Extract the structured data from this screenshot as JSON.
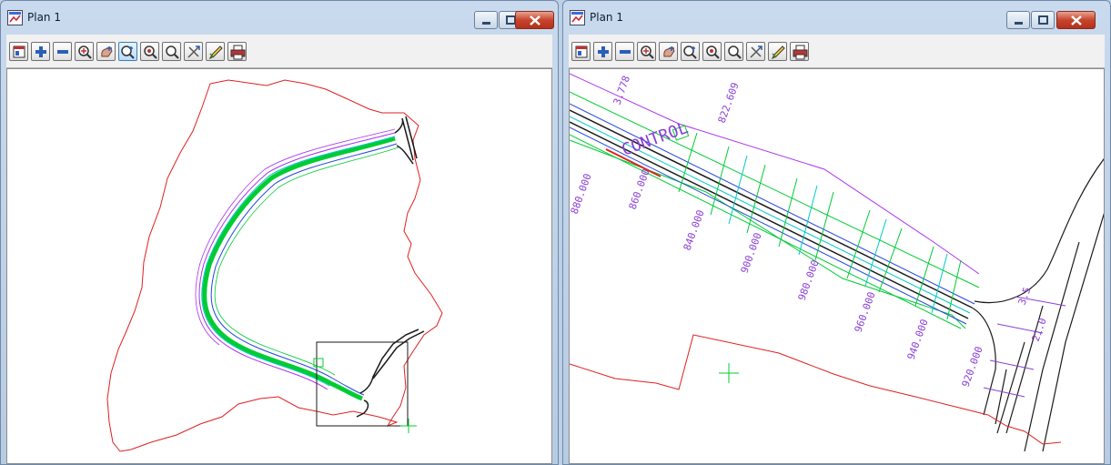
{
  "windows": [
    {
      "title": "Plan 1",
      "toolbar": [
        "plot-icon",
        "zoom-in-icon",
        "zoom-out-icon",
        "zoom-extents-icon",
        "pan-icon",
        "zoom-window-icon",
        "zoom-centre-icon",
        "zoom-previous-icon",
        "rotate-icon",
        "pick-icon",
        "print-icon"
      ],
      "active_tool": "zoom-window-icon"
    },
    {
      "title": "Plan 1",
      "toolbar": [
        "plot-icon",
        "zoom-in-icon",
        "zoom-out-icon",
        "zoom-extents-icon",
        "pan-icon",
        "zoom-window-icon",
        "zoom-centre-icon",
        "zoom-previous-icon",
        "rotate-icon",
        "pick-icon",
        "print-icon"
      ],
      "active_tool": "",
      "chainage_labels": [
        "920.000",
        "940.000",
        "960.000",
        "980.000",
        "900.000",
        "880.000",
        "860.000",
        "840.000",
        "3.778",
        "822.609",
        "3.5",
        "21.0"
      ],
      "road_label": "CONTROL"
    }
  ],
  "colors": {
    "boundary": "#e02020",
    "road": "#1a1a1a",
    "cross_sections": "#00cc33",
    "cyan": "#00c8c8",
    "magenta": "#aa33ee",
    "blue": "#2244dd",
    "label": "#8a3fd6"
  }
}
